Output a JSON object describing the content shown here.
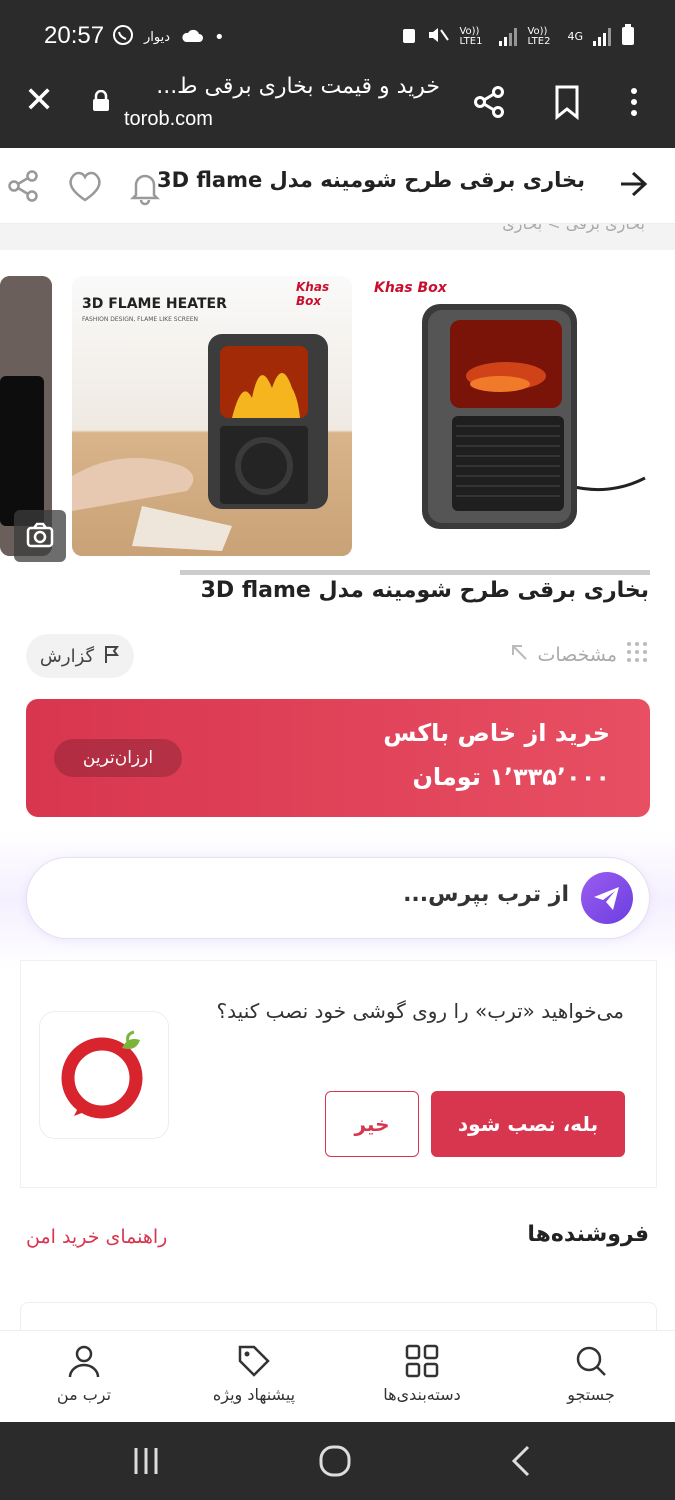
{
  "status_bar": {
    "time": "20:57",
    "app_label": "دیوار",
    "lte1": "Vo)) LTE1",
    "lte2": "Vo)) LTE2",
    "network": "4G"
  },
  "browser": {
    "page_title": "خرید و قیمت بخاری برقی ط...",
    "url": "torob.com"
  },
  "header": {
    "title": "بخاری برقی طرح شومینه مدل 3D flame"
  },
  "breadcrumb": {
    "text": "بخاری برقی  >  بخاری"
  },
  "gallery": {
    "image2_heading": "3D FLAME HEATER",
    "image2_sub": "FASHION DESIGN, FLAME LIKE SCREEN",
    "brand_logo": "Khas Box"
  },
  "product": {
    "title": "بخاری برقی طرح شومینه مدل 3D flame",
    "specs_label": "مشخصات",
    "report_label": "گزارش"
  },
  "buy_box": {
    "store": "خرید از خاص باکس",
    "price": "۱٬۳۳۵٬۰۰۰ تومان",
    "badge": "ارزان‌ترین"
  },
  "ask": {
    "placeholder": "از ترب بپرس..."
  },
  "install_prompt": {
    "message": "می‌خواهید «ترب» را روی گوشی خود نصب کنید؟",
    "yes_label": "بله، نصب شود",
    "no_label": "خیر"
  },
  "sellers": {
    "title": "فروشنده‌ها",
    "safe_guide": "راهنمای خرید امن"
  },
  "bottom_nav": {
    "search": "جستجو",
    "categories": "دسته‌بندی‌ها",
    "offers": "پیشنهاد ویژه",
    "my_torob": "ترب من"
  },
  "colors": {
    "accent": "#d8364f",
    "dark_bar": "#2b2b2b",
    "ask_button": "#7b4be6"
  }
}
